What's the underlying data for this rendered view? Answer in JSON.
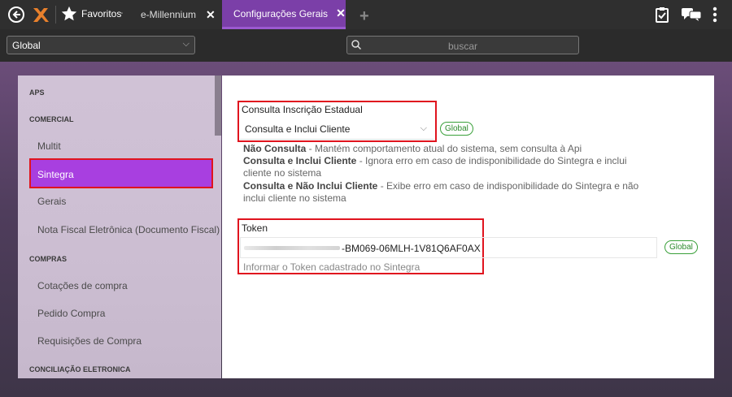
{
  "topbar": {
    "favorites_label": "Favoritos",
    "favorites_caret": "-",
    "tabs": [
      {
        "label": "e-Millennium",
        "close": "✕"
      },
      {
        "label": "Configurações Gerais",
        "close": "✕"
      }
    ],
    "new_tab": "+"
  },
  "toolbar": {
    "scope_select": "Global",
    "scope_chevron": "⌵",
    "search_placeholder": "buscar"
  },
  "sidebar": {
    "sections": [
      {
        "label": "APS"
      },
      {
        "label": "COMERCIAL"
      },
      {
        "label": "COMPRAS"
      },
      {
        "label": "CONCILIAÇÃO ELETRONICA"
      }
    ],
    "items": [
      {
        "label": "Multit"
      },
      {
        "label": "Sintegra"
      },
      {
        "label": "Gerais"
      },
      {
        "label": "Nota Fiscal Eletrônica (Documento Fiscal)"
      },
      {
        "label": "Cotações de compra"
      },
      {
        "label": "Pedido Compra"
      },
      {
        "label": "Requisições de Compra"
      }
    ]
  },
  "main": {
    "consulta": {
      "label": "Consulta Inscrição Estadual",
      "value": "Consulta e Inclui Cliente",
      "chevron": "⌵",
      "scope_badge": "Global",
      "options": [
        {
          "title": "Não Consulta",
          "text": " - Mantém comportamento atual do sistema, sem consulta à Api"
        },
        {
          "title": "Consulta e Inclui Cliente",
          "text": " - Ignora erro em caso de indisponibilidade do Sintegra e inclui cliente no sistema"
        },
        {
          "title": "Consulta e Não Inclui Cliente",
          "text": " - Exibe erro em caso de indisponibilidade do Sintegra e não inclui cliente no sistema"
        }
      ]
    },
    "token": {
      "label": "Token",
      "value": "-BM069-06MLH-1V81Q6AF0AX",
      "scope_badge": "Global",
      "hint": "Informar o Token cadastrado no Sintegra"
    }
  },
  "colors": {
    "active_tab": "#7b3fa8",
    "active_item": "#a83fe0",
    "highlight_border": "#e0141e",
    "badge_green": "#2b8a2b"
  }
}
